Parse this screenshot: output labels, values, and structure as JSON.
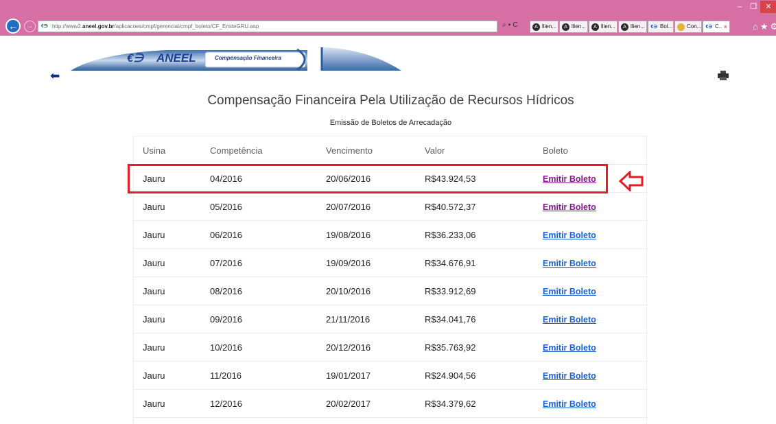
{
  "browser": {
    "url_prefix": "http://www2.",
    "url_host": "aneel.gov.br",
    "url_path": "/aplicacoes/cmpf/gerencial/cmpf_boleto/CF_EmiteGRU.asp",
    "search_refresh": "⌕ ▾ C",
    "tabs": [
      {
        "label": "llien...",
        "icon": "a-icon"
      },
      {
        "label": "llien...",
        "icon": "a-icon"
      },
      {
        "label": "llien...",
        "icon": "a-icon"
      },
      {
        "label": "llien...",
        "icon": "a-icon"
      },
      {
        "label": "Bol...",
        "icon": "aneel-icon"
      },
      {
        "label": "Con...",
        "icon": "conv-icon"
      },
      {
        "label": "C..",
        "icon": "aneel-icon",
        "active": true
      }
    ],
    "tab_close": "×",
    "win_min": "–",
    "win_max": "❐",
    "win_close": "✕",
    "toolbar_icons": "⌂★⚙"
  },
  "header": {
    "logo_mark": "€∋",
    "logo_word": "ANEEL",
    "banner_label": "Compensação Financeira",
    "back_icon": "back-arrow-icon",
    "print_icon": "printer-icon"
  },
  "page": {
    "title": "Compensação Financeira Pela Utilização de Recursos Hídricos",
    "subtitle": "Emissão de Boletos de Arrecadação"
  },
  "table": {
    "columns": [
      "Usina",
      "Competência",
      "Vencimento",
      "Valor",
      "Boleto"
    ],
    "rows": [
      {
        "usina": "Jauru",
        "competencia": "04/2016",
        "vencimento": "20/06/2016",
        "valor": "R$43.924,53",
        "boleto": "Emitir Boleto",
        "visited": true,
        "highlighted": true
      },
      {
        "usina": "Jauru",
        "competencia": "05/2016",
        "vencimento": "20/07/2016",
        "valor": "R$40.572,37",
        "boleto": "Emitir Boleto",
        "visited": true
      },
      {
        "usina": "Jauru",
        "competencia": "06/2016",
        "vencimento": "19/08/2016",
        "valor": "R$36.233,06",
        "boleto": "Emitir Boleto"
      },
      {
        "usina": "Jauru",
        "competencia": "07/2016",
        "vencimento": "19/09/2016",
        "valor": "R$34.676,91",
        "boleto": "Emitir Boleto"
      },
      {
        "usina": "Jauru",
        "competencia": "08/2016",
        "vencimento": "20/10/2016",
        "valor": "R$33.912,69",
        "boleto": "Emitir Boleto"
      },
      {
        "usina": "Jauru",
        "competencia": "09/2016",
        "vencimento": "21/11/2016",
        "valor": "R$34.041,76",
        "boleto": "Emitir Boleto"
      },
      {
        "usina": "Jauru",
        "competencia": "10/2016",
        "vencimento": "20/12/2016",
        "valor": "R$35.763,92",
        "boleto": "Emitir Boleto"
      },
      {
        "usina": "Jauru",
        "competencia": "11/2016",
        "vencimento": "19/01/2017",
        "valor": "R$24.904,56",
        "boleto": "Emitir Boleto"
      },
      {
        "usina": "Jauru",
        "competencia": "12/2016",
        "vencimento": "20/02/2017",
        "valor": "R$34.379,62",
        "boleto": "Emitir Boleto"
      }
    ]
  },
  "annotation": {
    "highlight_color": "#e21d2a",
    "arrow_icon": "outline-left-arrow-icon"
  },
  "colors": {
    "titlebar": "#d66fa4",
    "link": "#1a62d8",
    "link_visited": "#85168f",
    "aneel_blue": "#1d3f8f"
  }
}
